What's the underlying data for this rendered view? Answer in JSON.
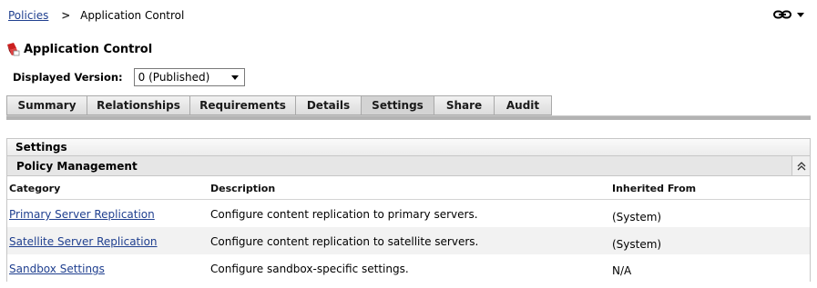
{
  "breadcrumb": {
    "parent": "Policies",
    "current": "Application Control"
  },
  "page": {
    "title": "Application Control"
  },
  "version": {
    "label": "Displayed Version:",
    "value": "0 (Published)"
  },
  "tabs": [
    {
      "label": "Summary"
    },
    {
      "label": "Relationships"
    },
    {
      "label": "Requirements"
    },
    {
      "label": "Details"
    },
    {
      "label": "Settings"
    },
    {
      "label": "Share"
    },
    {
      "label": "Audit"
    }
  ],
  "panel": {
    "title": "Settings",
    "section": "Policy Management",
    "columns": {
      "category": "Category",
      "description": "Description",
      "inherited": "Inherited From"
    },
    "rows": [
      {
        "category": "Primary Server Replication",
        "description": "Configure content replication to primary servers.",
        "inherited": "(System)"
      },
      {
        "category": "Satellite Server Replication",
        "description": "Configure content replication to satellite servers.",
        "inherited": "(System)"
      },
      {
        "category": "Sandbox Settings",
        "description": "Configure sandbox-specific settings.",
        "inherited": "N/A"
      }
    ]
  },
  "colors": {
    "link": "#1f3f8f",
    "tab_active": "#d3d3d3",
    "icon_red": "#cc1f1f"
  }
}
